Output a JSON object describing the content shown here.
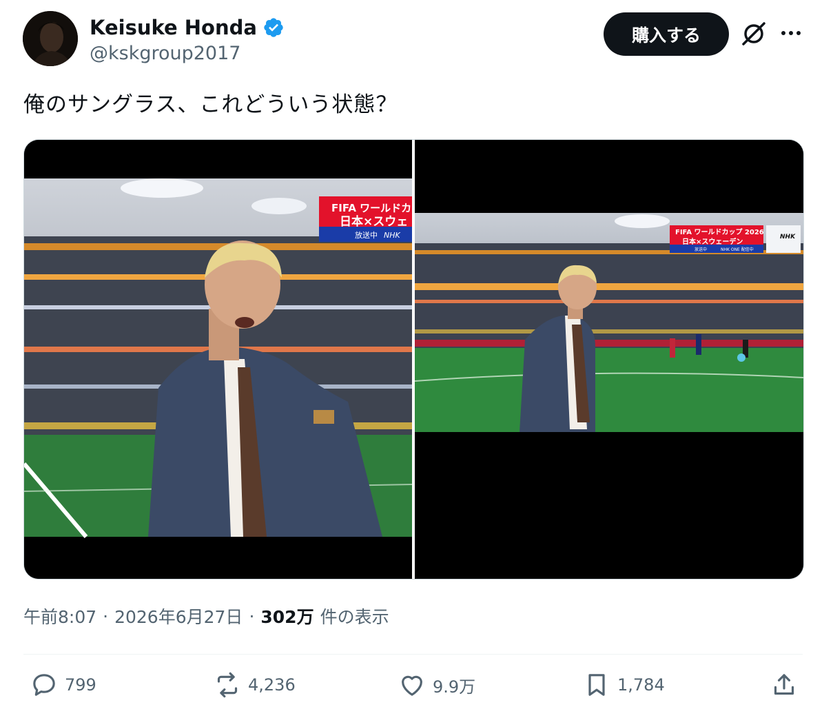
{
  "author": {
    "display_name": "Keisuke Honda",
    "handle": "@kskgroup2017",
    "verified": true
  },
  "header": {
    "buy_label": "購入する",
    "icons": [
      "grok-icon",
      "more-icon"
    ]
  },
  "tweet": {
    "text": "俺のサングラス、これどういう状態？"
  },
  "media": {
    "left": {
      "overlay_title": "FIFA ワールドカップ",
      "overlay_match": "日本×スウェ",
      "overlay_status": "放送中",
      "overlay_network": "NHK"
    },
    "right": {
      "overlay_title": "FIFA ワールドカップ 2026",
      "overlay_match": "日本×スウェーデン",
      "overlay_status": "放送中",
      "overlay_network": "NHK ONE 配信中",
      "network_logo": "NHK"
    }
  },
  "meta": {
    "time": "午前8:07",
    "date": "2026年6月27日",
    "views_count": "302万",
    "views_label": "件の表示"
  },
  "actions": {
    "replies": "799",
    "reposts": "4,236",
    "likes": "9.9万",
    "bookmarks": "1,784"
  },
  "colors": {
    "text": "#0f1419",
    "secondary": "#536471",
    "verified": "#1d9bf0",
    "divider": "#eff3f4",
    "pitch": "#2f7d3c",
    "broadcast_red": "#e3122b",
    "broadcast_blue": "#1a3ca8"
  }
}
